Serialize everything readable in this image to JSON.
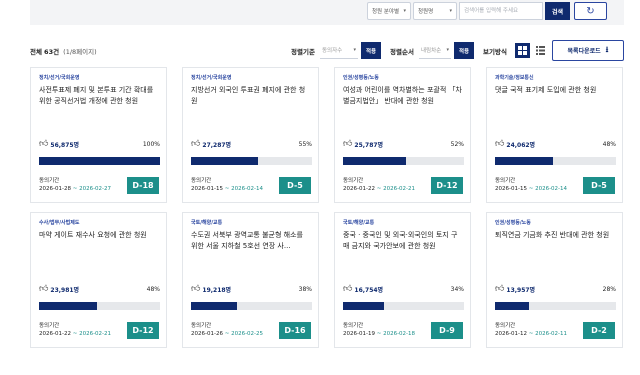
{
  "search": {
    "field_filter": "청원 분야별",
    "status_filter": "청원명",
    "placeholder": "검색어를 입력해 주세요",
    "search_label": "검색",
    "refresh_icon": "refresh-icon"
  },
  "toolbar": {
    "total_prefix": "전체",
    "total_count": "63건",
    "pages": "(1/8페이지)",
    "sort_label": "정렬기준",
    "sort_value": "동의자수",
    "sort_apply": "적용",
    "order_label": "정렬순서",
    "order_value": "내림차순",
    "order_apply": "적용",
    "view_label": "보기방식",
    "download_label": "목록다운로드"
  },
  "colors": {
    "navy": "#0f2a6e",
    "teal": "#1c8f8a",
    "bar_bg": "#e6e8eb"
  },
  "petitions": [
    {
      "category": "정치/선거/국회운영",
      "title": "사전투표제 폐지 및 본투표 기간 확대를 위한 공직선거법 개정에 관한 청원",
      "count": "56,875명",
      "percent": "100%",
      "fill": 1.0,
      "period_label": "동의기간",
      "start": "2026-01-28",
      "end": "2026-02-27",
      "dday": "D-18"
    },
    {
      "category": "정치/선거/국회운영",
      "title": "지방선거 외국인 투표권 폐지에 관한 청원",
      "count": "27,287명",
      "percent": "55%",
      "fill": 0.55,
      "period_label": "동의기간",
      "start": "2026-01-15",
      "end": "2026-02-14",
      "dday": "D-5"
    },
    {
      "category": "인권/성평등/노동",
      "title": "여성과 어린이를 역차별하는 포괄적 「차별금지법안」 반대에 관한 청원",
      "count": "25,787명",
      "percent": "52%",
      "fill": 0.52,
      "period_label": "동의기간",
      "start": "2026-01-22",
      "end": "2026-02-21",
      "dday": "D-12"
    },
    {
      "category": "과학기술/정보통신",
      "title": "댓글 국적 표기제 도입에 관한 청원",
      "count": "24,062명",
      "percent": "48%",
      "fill": 0.48,
      "period_label": "동의기간",
      "start": "2026-01-15",
      "end": "2026-02-14",
      "dday": "D-5"
    },
    {
      "category": "수사/법무/사법제도",
      "title": "마약 게이트 재수사 요청에 관한 청원",
      "count": "23,981명",
      "percent": "48%",
      "fill": 0.48,
      "period_label": "동의기간",
      "start": "2026-01-22",
      "end": "2026-02-21",
      "dday": "D-12"
    },
    {
      "category": "국토/해양/교통",
      "title": "수도권 서북부 광역교통 불균형 해소를 위한 서울 지하철 5호선 연장 사...",
      "count": "19,218명",
      "percent": "38%",
      "fill": 0.38,
      "period_label": "동의기간",
      "start": "2026-01-26",
      "end": "2026-02-25",
      "dday": "D-16"
    },
    {
      "category": "국토/해양/교통",
      "title": "중국 · 중국인 및 외국·외국인의 토지 구매 금지와 국가안보에 관한 청원",
      "count": "16,754명",
      "percent": "34%",
      "fill": 0.34,
      "period_label": "동의기간",
      "start": "2026-01-19",
      "end": "2026-02-18",
      "dday": "D-9"
    },
    {
      "category": "인권/성평등/노동",
      "title": "퇴직연금 기금화 추진 반대에 관한 청원",
      "count": "13,957명",
      "percent": "28%",
      "fill": 0.28,
      "period_label": "동의기간",
      "start": "2026-01-12",
      "end": "2026-02-11",
      "dday": "D-2"
    }
  ]
}
